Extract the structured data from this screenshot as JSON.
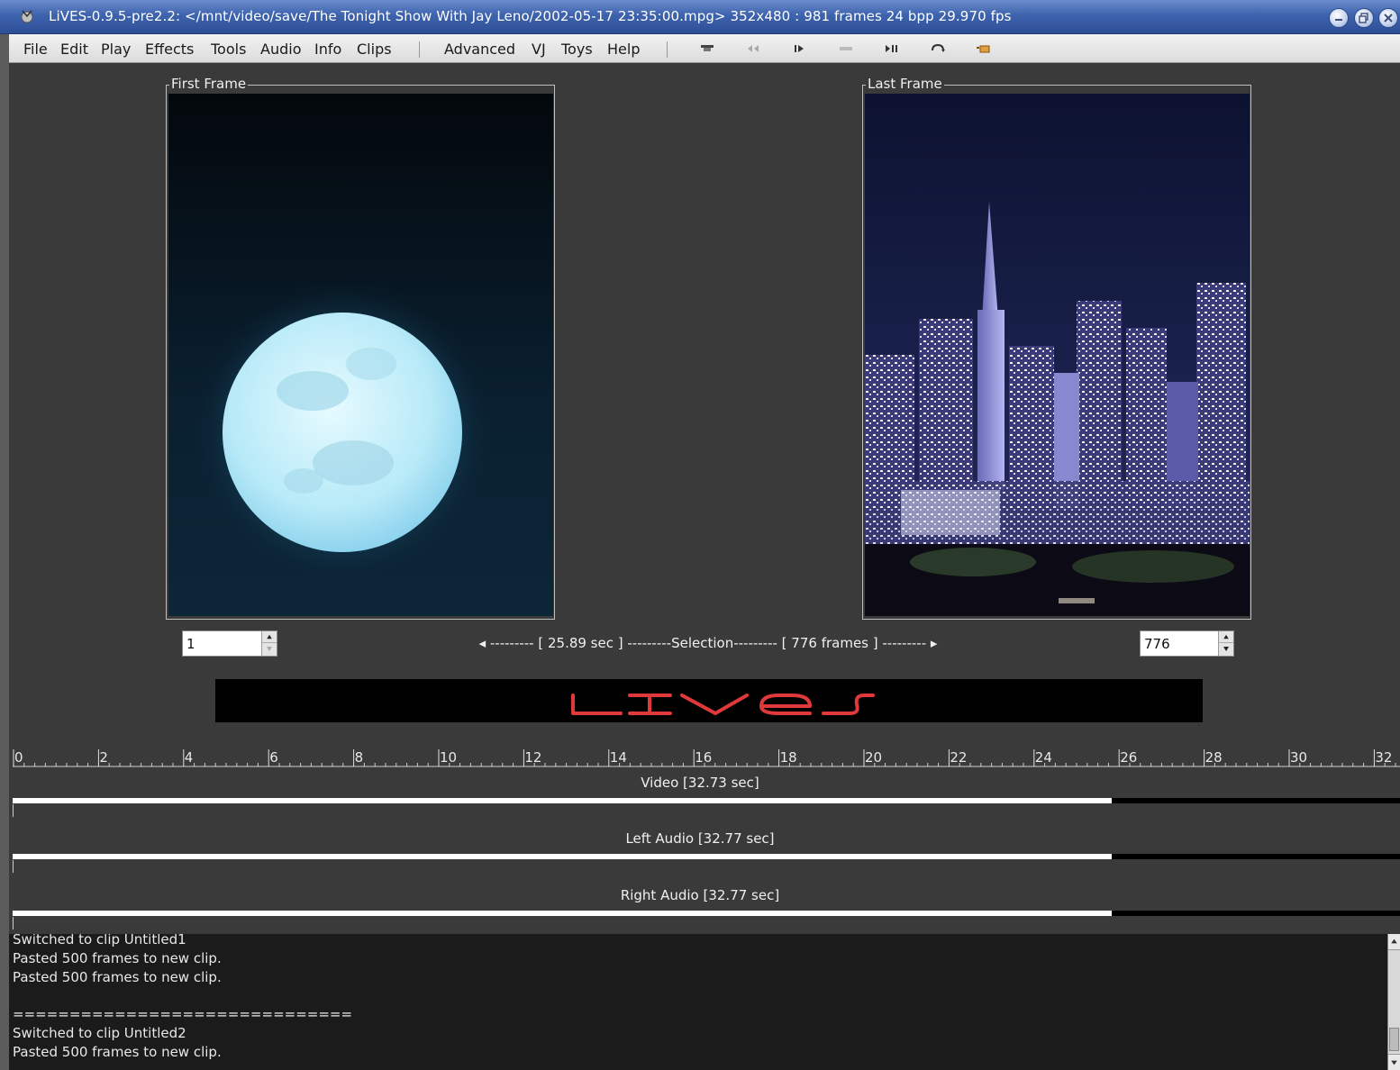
{
  "window": {
    "title": "LiVES-0.9.5-pre2.2: </mnt/video/save/The Tonight Show With Jay Leno/2002-05-17 23:35:00.mpg> 352x480 : 981 frames 24 bpp 29.970 fps",
    "icon": "lives-app-icon",
    "controls": [
      "minimize-icon",
      "maximize-icon",
      "close-icon"
    ]
  },
  "menubar": {
    "items": [
      "File",
      "Edit",
      "Play",
      "Effects",
      "Tools",
      "Audio",
      "Info",
      "Clips",
      "Advanced",
      "VJ",
      "Toys",
      "Help"
    ],
    "toolbar_icons": [
      "stop-icon",
      "rewind-icon",
      "play-icon",
      "play-selection-icon",
      "play-loop-icon",
      "loop-continuous-icon",
      "fullscreen-icon"
    ]
  },
  "frames": {
    "first_label": "First Frame",
    "last_label": "Last Frame",
    "start_value": "1",
    "end_value": "776"
  },
  "selection": {
    "text": "◂ --------- [ 25.89 sec ] ---------Selection--------- [ 776 frames ] --------- ▸"
  },
  "logo": {
    "text": "LIVES"
  },
  "timeline": {
    "ruler_labels": [
      "0",
      "2",
      "4",
      "6",
      "8",
      "10",
      "12",
      "14",
      "16",
      "18",
      "20",
      "22",
      "24",
      "26",
      "28",
      "30",
      "32"
    ],
    "tracks": [
      {
        "label": "Video [32.73 sec]",
        "selected_fraction": 0.792
      },
      {
        "label": "Left Audio [32.77 sec]",
        "selected_fraction": 0.792
      },
      {
        "label": "Right Audio [32.77 sec]",
        "selected_fraction": 0.792
      }
    ]
  },
  "log": {
    "lines": [
      "Switched to clip Untitled1",
      "Pasted 500 frames to new clip.",
      "Pasted 500 frames to new clip.",
      "",
      "==============================",
      "Switched to clip Untitled2",
      "Pasted 500 frames to new clip."
    ]
  },
  "colors": {
    "titlebar": "#3e63ad",
    "background": "#3a3a3a",
    "logo": "#e0393b",
    "log_background": "#1b1b1b"
  }
}
